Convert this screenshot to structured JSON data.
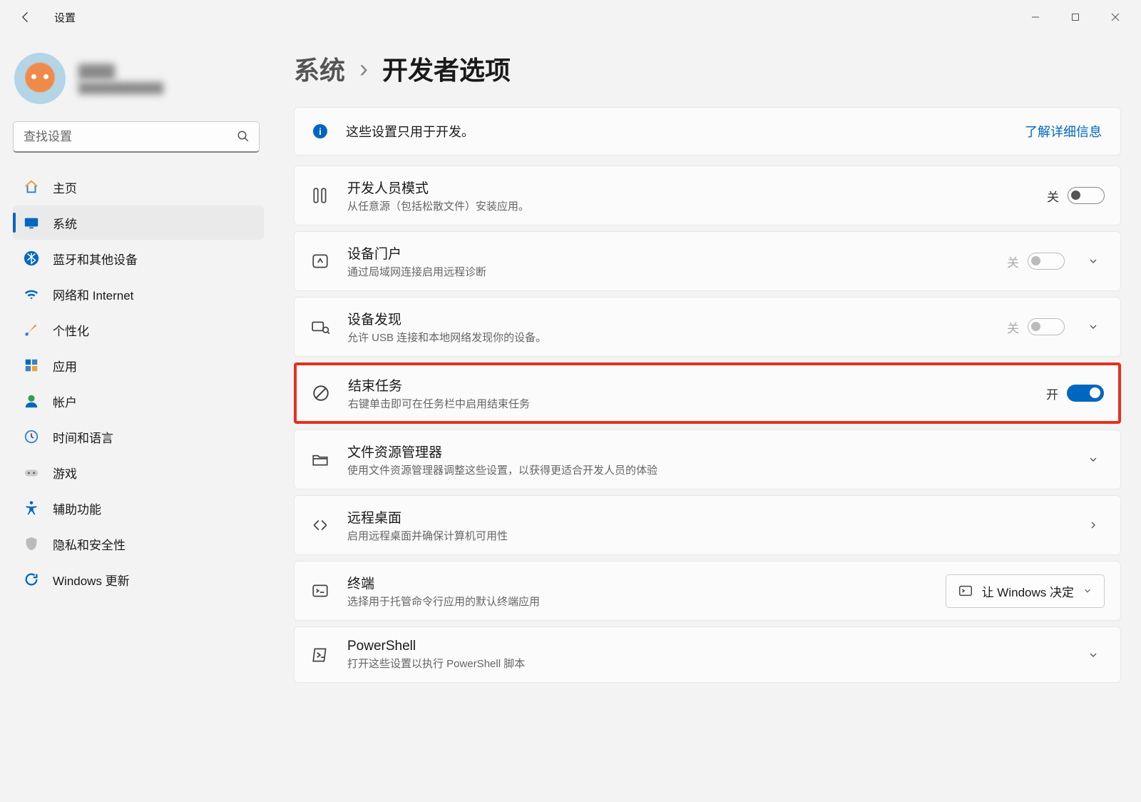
{
  "app_title": "设置",
  "user": {
    "name": "████",
    "sub": "████████████"
  },
  "search": {
    "placeholder": "查找设置"
  },
  "nav": [
    {
      "id": "home",
      "label": "主页"
    },
    {
      "id": "system",
      "label": "系统"
    },
    {
      "id": "bluetooth",
      "label": "蓝牙和其他设备"
    },
    {
      "id": "network",
      "label": "网络和 Internet"
    },
    {
      "id": "personalize",
      "label": "个性化"
    },
    {
      "id": "apps",
      "label": "应用"
    },
    {
      "id": "accounts",
      "label": "帐户"
    },
    {
      "id": "time",
      "label": "时间和语言"
    },
    {
      "id": "gaming",
      "label": "游戏"
    },
    {
      "id": "accessibility",
      "label": "辅助功能"
    },
    {
      "id": "privacy",
      "label": "隐私和安全性"
    },
    {
      "id": "update",
      "label": "Windows 更新"
    }
  ],
  "breadcrumb": {
    "parent": "系统",
    "sep": "›",
    "current": "开发者选项"
  },
  "banner": {
    "text": "这些设置只用于开发。",
    "link": "了解详细信息"
  },
  "toggle_labels": {
    "on": "开",
    "off": "关"
  },
  "cards": {
    "dev_mode": {
      "title": "开发人员模式",
      "desc": "从任意源（包括松散文件）安装应用。",
      "state": "off"
    },
    "device_portal": {
      "title": "设备门户",
      "desc": "通过局域网连接启用远程诊断",
      "state": "off_disabled"
    },
    "device_discovery": {
      "title": "设备发现",
      "desc": "允许 USB 连接和本地网络发现你的设备。",
      "state": "off_disabled"
    },
    "end_task": {
      "title": "结束任务",
      "desc": "右键单击即可在任务栏中启用结束任务",
      "state": "on"
    },
    "explorer": {
      "title": "文件资源管理器",
      "desc": "使用文件资源管理器调整这些设置，以获得更适合开发人员的体验"
    },
    "remote_desktop": {
      "title": "远程桌面",
      "desc": "启用远程桌面并确保计算机可用性"
    },
    "terminal": {
      "title": "终端",
      "desc": "选择用于托管命令行应用的默认终端应用",
      "dropdown": "让 Windows 决定"
    },
    "powershell": {
      "title": "PowerShell",
      "desc": "打开这些设置以执行 PowerShell 脚本"
    }
  }
}
